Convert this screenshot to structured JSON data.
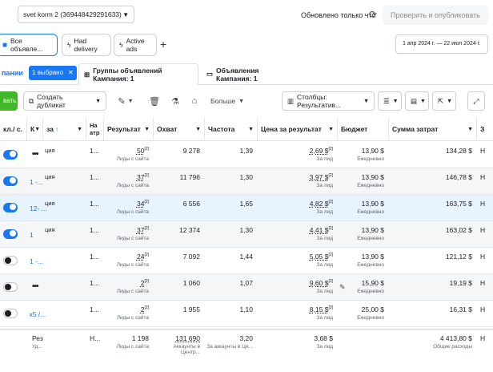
{
  "header": {
    "account": "svet korm 2 (369448429291633)",
    "updated": "Обновлено только что",
    "publish": "Проверить и опубликовать"
  },
  "filters": {
    "all_ads": "Все объявле...",
    "had_delivery": "Had delivery",
    "active_ads": "Active ads",
    "date_range": "1 апр 2024 г. — 22 июл 2024 г."
  },
  "tabs": {
    "campaigns": "пании",
    "selected": "1 выбрано",
    "adsets": "Группы объявлений Кампания: 1",
    "ads": "Объявления Кампания: 1"
  },
  "toolbar": {
    "create": "вать",
    "duplicate": "Создать дубликат",
    "more": "Больше",
    "columns": "Столбцы: Результатив..."
  },
  "columns": {
    "status": "кл./ с.",
    "k": "К",
    "name": "за",
    "delivery": "На атр",
    "results": "Результат",
    "reach": "Охват",
    "frequency": "Частота",
    "cost_per_result": "Цена за результат",
    "budget": "Бюджет",
    "spend": "Сумма затрат",
    "extra": "З"
  },
  "rows": [
    {
      "on": true,
      "id": "",
      "dots": "•••",
      "name": "ция",
      "delivery": "1...",
      "result": "50",
      "result_sub": "Лиды с сайта",
      "reach": "9 278",
      "freq": "1,39",
      "cpr": "2,69 $",
      "cpr_sub": "За лид",
      "budget": "13,90 $",
      "budget_sub": "Ежедневно",
      "spend": "134,28 $",
      "extra": "Н"
    },
    {
      "on": true,
      "id": "1 -...",
      "dots": "",
      "name": "ция",
      "delivery": "1...",
      "result": "37",
      "result_sub": "Лиды с сайта",
      "reach": "11 796",
      "freq": "1,30",
      "cpr": "3,97 $",
      "cpr_sub": "За лид",
      "budget": "13,90 $",
      "budget_sub": "Ежедневно",
      "spend": "146,78 $",
      "extra": "Н"
    },
    {
      "on": true,
      "id": "12- ...",
      "dots": "",
      "name": "ция",
      "delivery": "1...",
      "result": "34",
      "result_sub": "Лиды с сайта",
      "reach": "6 556",
      "freq": "1,65",
      "cpr": "4,82 $",
      "cpr_sub": "За лид",
      "budget": "13,90 $",
      "budget_sub": "Ежедневно",
      "spend": "163,75 $",
      "extra": "Н"
    },
    {
      "on": true,
      "id": "1",
      "dots": "",
      "name": "ция",
      "delivery": "1...",
      "result": "37",
      "result_sub": "Лиды с сайта",
      "reach": "12 374",
      "freq": "1,30",
      "cpr": "4,41 $",
      "cpr_sub": "За лид",
      "budget": "13,90 $",
      "budget_sub": "Ежедневно",
      "spend": "163,02 $",
      "extra": "Н"
    },
    {
      "on": false,
      "id": "1 -...",
      "dots": "",
      "name": "",
      "delivery": "1...",
      "result": "24",
      "result_sub": "Лиды с сайта",
      "reach": "7 092",
      "freq": "1,44",
      "cpr": "5,05 $",
      "cpr_sub": "За лид",
      "budget": "13,90 $",
      "budget_sub": "Ежедневно",
      "spend": "121,12 $",
      "extra": "Н"
    },
    {
      "on": false,
      "id": "",
      "dots": "•••",
      "name": "",
      "delivery": "1...",
      "result": "2",
      "result_sub": "Лиды с сайта",
      "reach": "1 060",
      "freq": "1,07",
      "cpr": "9,60 $",
      "cpr_sub": "За лид",
      "budget": "15,90 $",
      "budget_sub": "Ежедневно",
      "spend": "19,19 $",
      "extra": "Н"
    },
    {
      "on": false,
      "id": "к5 /...",
      "dots": "",
      "name": "",
      "delivery": "1...",
      "result": "2",
      "result_sub": "Лиды с сайта",
      "reach": "1 955",
      "freq": "1,10",
      "cpr": "8,15 $",
      "cpr_sub": "За лид",
      "budget": "25,00 $",
      "budget_sub": "Ежедневно",
      "spend": "16,31 $",
      "extra": "Н"
    }
  ],
  "totals": {
    "label": "Рез",
    "label_sub": "Уд...",
    "delivery": "Н...",
    "result": "1 198",
    "result_sub": "Лиды с сайта",
    "reach": "131 690",
    "reach_sub": "Аккаунты в Центр...",
    "freq": "3,20",
    "freq_sub": "За аккаунты в Це...",
    "cpr": "3,68 $",
    "cpr_sub": "За лид",
    "spend": "4 413,80 $",
    "spend_sub": "Общие расходы",
    "extra": "Н"
  }
}
